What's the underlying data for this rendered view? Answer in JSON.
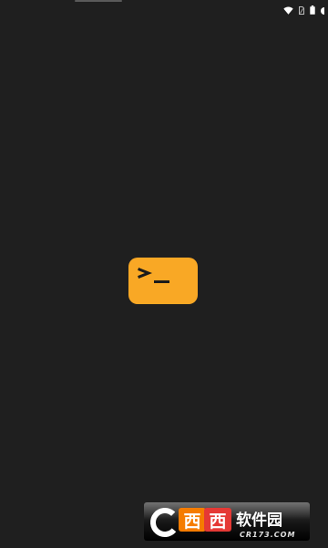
{
  "status_bar": {
    "icons": [
      "wifi-icon",
      "sim-card-icon",
      "battery-icon",
      "status-dot-icon"
    ]
  },
  "splash": {
    "logo_icon": "terminal-prompt-icon",
    "logo_glyph": ">_",
    "logo_color": "#f9a825",
    "background_color": "#1f1f1f"
  },
  "watermark": {
    "logo_text": "西西软件园",
    "site_text": "CR173.COM"
  }
}
